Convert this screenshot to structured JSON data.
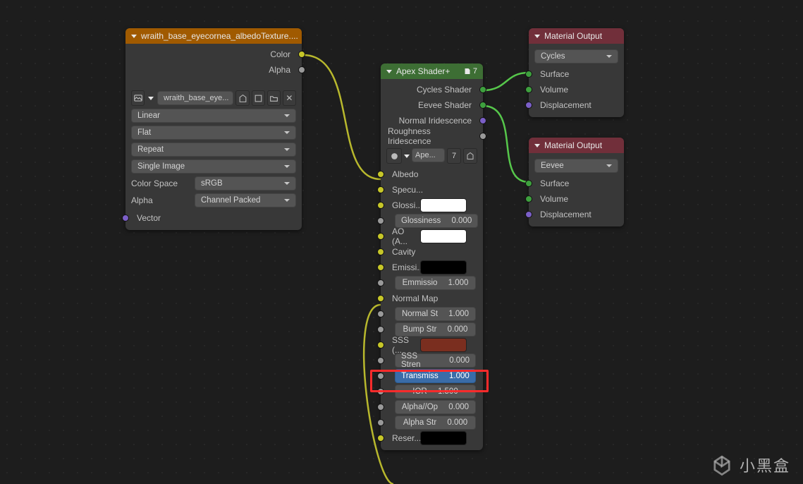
{
  "texNode": {
    "title": "wraith_base_eyecornea_albedoTexture....",
    "out_color": "Color",
    "out_alpha": "Alpha",
    "image_name": "wraith_base_eye...",
    "interp": "Linear",
    "projection": "Flat",
    "extension": "Repeat",
    "mode": "Single Image",
    "cs_label": "Color Space",
    "cs_value": "sRGB",
    "alpha_label": "Alpha",
    "alpha_value": "Channel Packed",
    "vector": "Vector"
  },
  "apex": {
    "title": "Apex Shader+",
    "hdr_count": "7",
    "out_cycles": "Cycles Shader",
    "out_eevee": "Eevee Shader",
    "out_ni": "Normal Iridescence",
    "out_ri": "Roughness Iridescence",
    "nodegroup_name": "Ape...",
    "nodegroup_users": "7",
    "inputs": {
      "albedo": "Albedo",
      "specu": "Specu...",
      "glossi": "Glossi...",
      "gloss_field": "Glossiness",
      "gloss_val": "0.000",
      "ao": "AO (A...",
      "cavity": "Cavity",
      "emissi": "Emissi...",
      "emissio_field": "Emmissio",
      "emissio_val": "1.000",
      "normal": "Normal Map",
      "normal_st": "Normal St",
      "normal_st_val": "1.000",
      "bump": "Bump Str",
      "bump_val": "0.000",
      "sss": "SSS (...",
      "sss_stren": "SSS Stren",
      "sss_stren_val": "0.000",
      "transmiss": "Transmiss",
      "transmiss_val": "1.000",
      "ior": "IOR",
      "ior_val": "1.500",
      "alphaop": "Alpha//Op",
      "alphaop_val": "0.000",
      "alphastr": "Alpha Str",
      "alphastr_val": "0.000",
      "reser": "Reser..."
    }
  },
  "matOut": {
    "title": "Material Output",
    "cycles": "Cycles",
    "eevee": "Eevee",
    "surface": "Surface",
    "volume": "Volume",
    "disp": "Displacement"
  },
  "watermark": "小黑盒"
}
